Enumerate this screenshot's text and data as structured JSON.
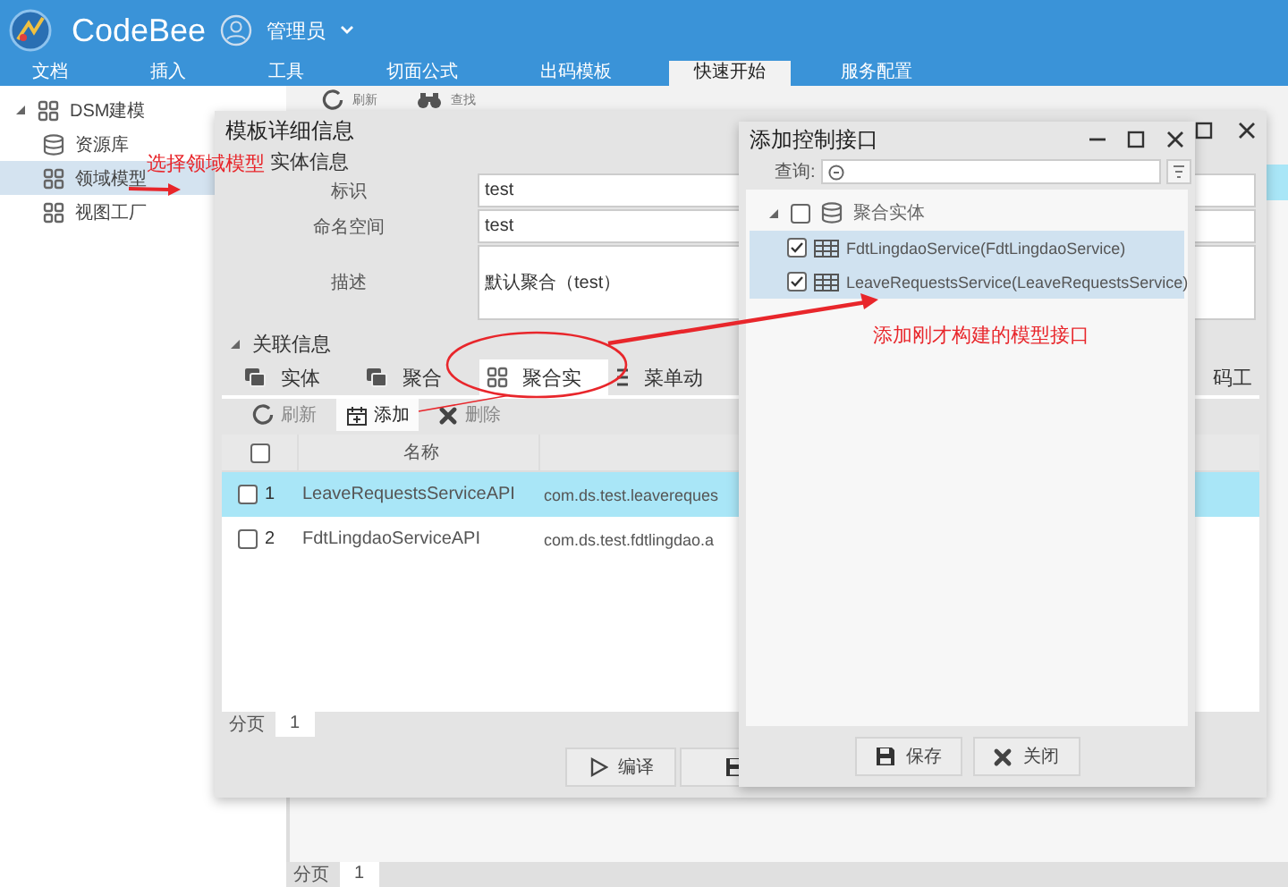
{
  "app": {
    "name": "CodeBee",
    "user": "管理员"
  },
  "menu_tabs": [
    {
      "label": "文档",
      "selected": false
    },
    {
      "label": "插入",
      "selected": false
    },
    {
      "label": "工具",
      "selected": false
    },
    {
      "label": "切面公式",
      "selected": false
    },
    {
      "label": "出码模板",
      "selected": false
    },
    {
      "label": "快速开始",
      "selected": true
    },
    {
      "label": "服务配置",
      "selected": false
    }
  ],
  "sidebar": {
    "items": [
      {
        "label": "DSM建模",
        "kind": "module",
        "expanded": true,
        "selected": false,
        "children": [
          {
            "label": "资源库",
            "kind": "database",
            "selected": false
          },
          {
            "label": "领域模型",
            "kind": "module",
            "selected": true
          },
          {
            "label": "视图工厂",
            "kind": "module",
            "selected": false
          }
        ]
      }
    ]
  },
  "main": {
    "toolbar": [
      {
        "kind": "refresh",
        "label": "刷新"
      },
      {
        "kind": "find",
        "label": "查找"
      }
    ],
    "rows": [
      {
        "selected": true
      }
    ],
    "pager": {
      "label": "分页",
      "page": "1"
    }
  },
  "detail_dialog": {
    "title": "模板详细信息",
    "entity_section": {
      "title": "实体信息",
      "fields": [
        {
          "label": "标识",
          "value": "test"
        },
        {
          "label": "命名空间",
          "value": "test"
        },
        {
          "label": "描述",
          "value": "默认聚合（test）"
        }
      ]
    },
    "related_section": {
      "title": "关联信息",
      "expanded": true,
      "tabs": [
        {
          "label": "实体",
          "kind": "stack",
          "selected": false
        },
        {
          "label": "聚合",
          "kind": "stack",
          "selected": false
        },
        {
          "label": "聚合实",
          "kind": "grid",
          "selected": true
        },
        {
          "label": "菜单动",
          "kind": "list",
          "selected": false
        },
        {
          "label": "码工",
          "kind": "none",
          "selected": false
        }
      ],
      "toolbar": [
        {
          "kind": "refresh",
          "label": "刷新",
          "hover": false
        },
        {
          "kind": "add",
          "label": "添加",
          "hover": true
        },
        {
          "kind": "delete",
          "label": "删除",
          "hover": false
        }
      ],
      "table": {
        "header_checked": false,
        "columns": [
          "名称"
        ],
        "rows": [
          {
            "index": "1",
            "name": "LeaveRequestsServiceAPI",
            "column_3": "com.ds.test.leavereques",
            "checked": false,
            "selected": true
          },
          {
            "index": "2",
            "name": "FdtLingdaoServiceAPI",
            "column_3": "com.ds.test.fdtlingdao.a",
            "checked": false,
            "selected": false
          }
        ]
      },
      "pager": {
        "label": "分页",
        "page": "1"
      }
    },
    "buttons": [
      {
        "kind": "compile",
        "label": "编译"
      },
      {
        "kind": "save"
      }
    ]
  },
  "add_dialog": {
    "title": "添加控制接口",
    "search": {
      "label": "查询:"
    },
    "tree": {
      "label": "聚合实体",
      "checked": false,
      "expanded": true,
      "children": [
        {
          "label": "FdtLingdaoService(FdtLingdaoService)",
          "checked": true,
          "selected": true
        },
        {
          "label": "LeaveRequestsService(LeaveRequestsService)",
          "checked": true,
          "selected": true
        }
      ]
    },
    "buttons": [
      {
        "kind": "save",
        "label": "保存"
      },
      {
        "kind": "close",
        "label": "关闭"
      }
    ]
  },
  "annotations": [
    {
      "text": "选择领域模型"
    },
    {
      "text": "添加刚才构建的模型接口"
    }
  ]
}
